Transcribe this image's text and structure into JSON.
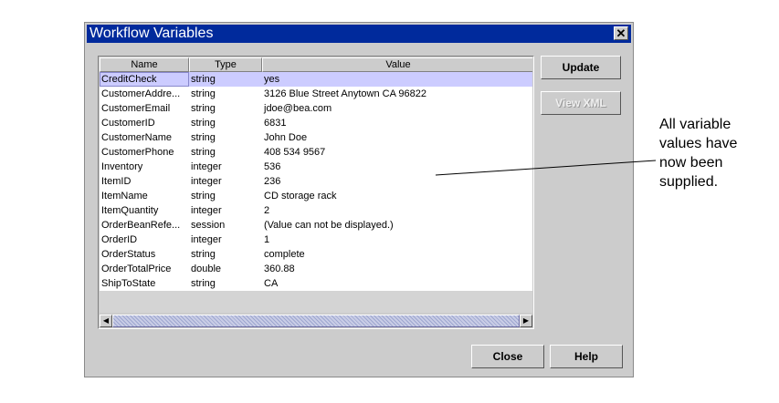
{
  "window": {
    "title": "Workflow Variables",
    "close_glyph": "✕"
  },
  "table": {
    "columns": [
      "Name",
      "Type",
      "Value"
    ],
    "rows": [
      {
        "name": "CreditCheck",
        "type": "string",
        "value": "yes"
      },
      {
        "name": "CustomerAddre...",
        "type": "string",
        "value": "3126 Blue Street Anytown CA 96822"
      },
      {
        "name": "CustomerEmail",
        "type": "string",
        "value": "jdoe@bea.com"
      },
      {
        "name": "CustomerID",
        "type": "string",
        "value": "6831"
      },
      {
        "name": "CustomerName",
        "type": "string",
        "value": "John Doe"
      },
      {
        "name": "CustomerPhone",
        "type": "string",
        "value": "408 534 9567"
      },
      {
        "name": "Inventory",
        "type": "integer",
        "value": "536"
      },
      {
        "name": "ItemID",
        "type": "integer",
        "value": "236"
      },
      {
        "name": "ItemName",
        "type": "string",
        "value": "CD storage rack"
      },
      {
        "name": "ItemQuantity",
        "type": "integer",
        "value": "2"
      },
      {
        "name": "OrderBeanRefe...",
        "type": "session",
        "value": "(Value can not be displayed.)"
      },
      {
        "name": "OrderID",
        "type": "integer",
        "value": "1"
      },
      {
        "name": "OrderStatus",
        "type": "string",
        "value": "complete"
      },
      {
        "name": "OrderTotalPrice",
        "type": "double",
        "value": "360.88"
      },
      {
        "name": "ShipToState",
        "type": "string",
        "value": "CA"
      }
    ],
    "selected_row": "CreditCheck"
  },
  "scrollbar": {
    "left_arrow": "◀",
    "right_arrow": "▶"
  },
  "buttons": {
    "update": "Update",
    "view_xml": "View XML",
    "close": "Close",
    "help": "Help"
  },
  "annotation": {
    "text": "All variable values have now been supplied."
  },
  "colors": {
    "titlebar": "#002a9c",
    "dialog_bg": "#cccccc",
    "selection": "#ccccff"
  }
}
